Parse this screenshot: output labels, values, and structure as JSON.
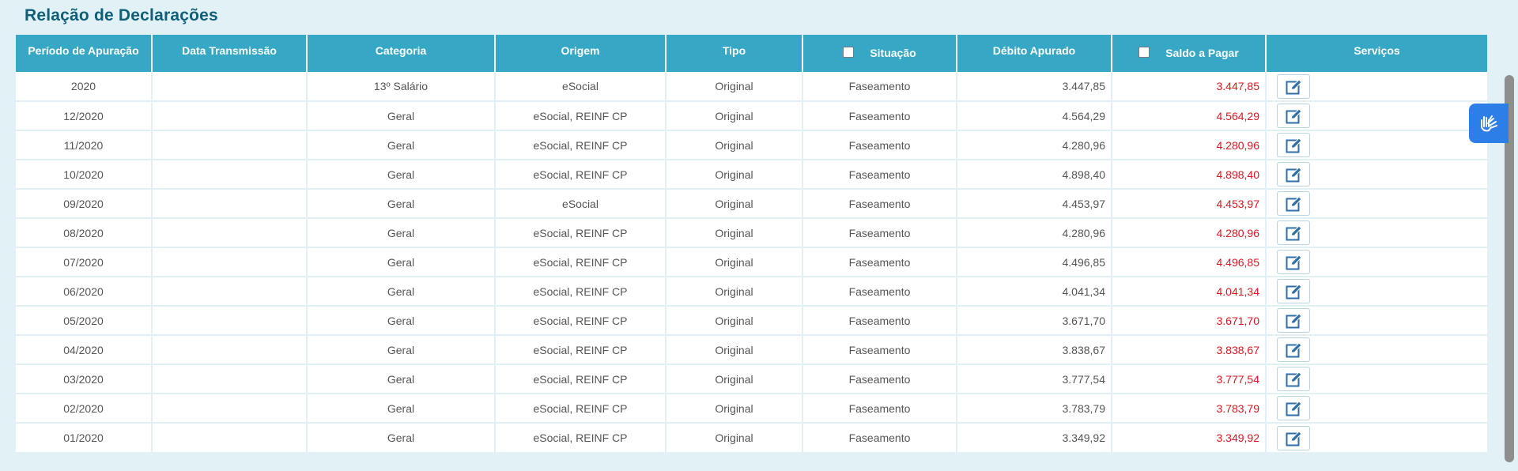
{
  "page": {
    "title": "Relação de Declarações"
  },
  "table": {
    "headers": {
      "periodo": "Período de Apuração",
      "data_transmissao": "Data Transmissão",
      "categoria": "Categoria",
      "origem": "Origem",
      "tipo": "Tipo",
      "situacao": "Situação",
      "debito": "Débito Apurado",
      "saldo": "Saldo a Pagar",
      "servicos": "Serviços"
    },
    "rows": [
      {
        "periodo": "2020",
        "data_transmissao": "",
        "categoria": "13º Salário",
        "origem": "eSocial",
        "tipo": "Original",
        "situacao": "Faseamento",
        "debito": "3.447,85",
        "saldo": "3.447,85"
      },
      {
        "periodo": "12/2020",
        "data_transmissao": "",
        "categoria": "Geral",
        "origem": "eSocial, REINF CP",
        "tipo": "Original",
        "situacao": "Faseamento",
        "debito": "4.564,29",
        "saldo": "4.564,29"
      },
      {
        "periodo": "11/2020",
        "data_transmissao": "",
        "categoria": "Geral",
        "origem": "eSocial, REINF CP",
        "tipo": "Original",
        "situacao": "Faseamento",
        "debito": "4.280,96",
        "saldo": "4.280,96"
      },
      {
        "periodo": "10/2020",
        "data_transmissao": "",
        "categoria": "Geral",
        "origem": "eSocial, REINF CP",
        "tipo": "Original",
        "situacao": "Faseamento",
        "debito": "4.898,40",
        "saldo": "4.898,40"
      },
      {
        "periodo": "09/2020",
        "data_transmissao": "",
        "categoria": "Geral",
        "origem": "eSocial",
        "tipo": "Original",
        "situacao": "Faseamento",
        "debito": "4.453,97",
        "saldo": "4.453,97"
      },
      {
        "periodo": "08/2020",
        "data_transmissao": "",
        "categoria": "Geral",
        "origem": "eSocial, REINF CP",
        "tipo": "Original",
        "situacao": "Faseamento",
        "debito": "4.280,96",
        "saldo": "4.280,96"
      },
      {
        "periodo": "07/2020",
        "data_transmissao": "",
        "categoria": "Geral",
        "origem": "eSocial, REINF CP",
        "tipo": "Original",
        "situacao": "Faseamento",
        "debito": "4.496,85",
        "saldo": "4.496,85"
      },
      {
        "periodo": "06/2020",
        "data_transmissao": "",
        "categoria": "Geral",
        "origem": "eSocial, REINF CP",
        "tipo": "Original",
        "situacao": "Faseamento",
        "debito": "4.041,34",
        "saldo": "4.041,34"
      },
      {
        "periodo": "05/2020",
        "data_transmissao": "",
        "categoria": "Geral",
        "origem": "eSocial, REINF CP",
        "tipo": "Original",
        "situacao": "Faseamento",
        "debito": "3.671,70",
        "saldo": "3.671,70"
      },
      {
        "periodo": "04/2020",
        "data_transmissao": "",
        "categoria": "Geral",
        "origem": "eSocial, REINF CP",
        "tipo": "Original",
        "situacao": "Faseamento",
        "debito": "3.838,67",
        "saldo": "3.838,67"
      },
      {
        "periodo": "03/2020",
        "data_transmissao": "",
        "categoria": "Geral",
        "origem": "eSocial, REINF CP",
        "tipo": "Original",
        "situacao": "Faseamento",
        "debito": "3.777,54",
        "saldo": "3.777,54"
      },
      {
        "periodo": "02/2020",
        "data_transmissao": "",
        "categoria": "Geral",
        "origem": "eSocial, REINF CP",
        "tipo": "Original",
        "situacao": "Faseamento",
        "debito": "3.783,79",
        "saldo": "3.783,79"
      },
      {
        "periodo": "01/2020",
        "data_transmissao": "",
        "categoria": "Geral",
        "origem": "eSocial, REINF CP",
        "tipo": "Original",
        "situacao": "Faseamento",
        "debito": "3.349,92",
        "saldo": "3.349,92"
      }
    ]
  },
  "icons": {
    "edit": "edit-icon",
    "accessibility": "sign-language-icon"
  },
  "colors": {
    "header_bg": "#37a7c6",
    "title": "#0f5f78",
    "saldo_text": "#e0141e",
    "a11y_button": "#2d7ee6"
  }
}
